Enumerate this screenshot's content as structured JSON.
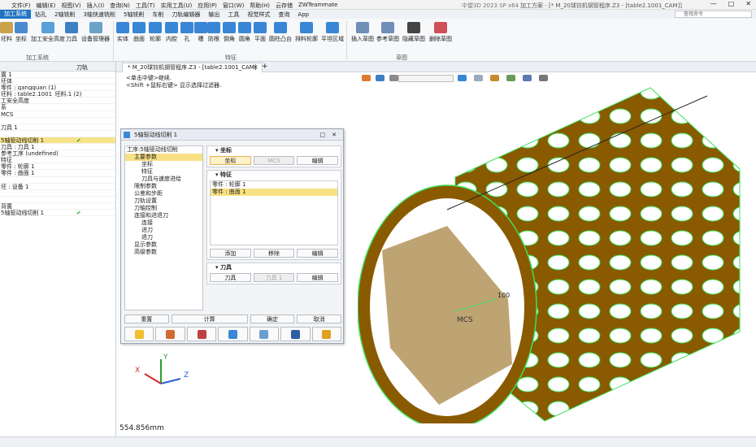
{
  "titlebar": {
    "menus": [
      "文件(F)",
      "编辑(E)",
      "视图(V)",
      "插入(I)",
      "查询(N)",
      "工具(T)",
      "实用工具(U)",
      "应用(P)",
      "窗口(W)",
      "帮助(H)",
      "云存储",
      "ZWTeammate"
    ],
    "product": "中望3D 2023 SP x64",
    "doc_title": "加工方案 - [* M_20球铰机钢管程序.Z3 - [table2.1001_CAM]]"
  },
  "tabs": [
    "加工系统",
    "钻孔",
    "2轴铣削",
    "3轴快速铣削",
    "5轴铣削",
    "车削",
    "刀轨编辑器",
    "输出",
    "工具",
    "视觉样式",
    "查询",
    "App"
  ],
  "search_placeholder": "查找命令",
  "ribbon": {
    "group1": {
      "label": "加工系统",
      "buttons": [
        "坯料",
        "坐标",
        "加工安全高度",
        "刀具",
        "设备管理器"
      ]
    },
    "group2": {
      "label": "特征",
      "buttons": [
        "实体",
        "曲面",
        "轮廓",
        "内腔",
        "孔",
        "槽",
        "防根",
        "倒角",
        "圆角",
        "平面",
        "圆柱凸台",
        "排料轮廓",
        "平坦区域"
      ]
    },
    "group3": {
      "label": "草图",
      "buttons": [
        "插入草图",
        "参考草图",
        "隐藏草图",
        "删除草图"
      ]
    }
  },
  "leftpanel": {
    "col": "刀轨",
    "rows": [
      {
        "t": "置 1"
      },
      {
        "t": "坯体"
      },
      {
        "t": "零件 : gangguan (1)"
      },
      {
        "t": "坯料 : table2.1001_坯料.1 (2)"
      },
      {
        "t": "工安全高度"
      },
      {
        "t": "系"
      },
      {
        "t": "MCS"
      },
      {
        "t": ""
      },
      {
        "t": "刀具 1"
      },
      {
        "t": ""
      },
      {
        "t": "5轴驱动线切削 1",
        "sel": true,
        "check": true
      },
      {
        "t": "刀具 : 刀具 1"
      },
      {
        "t": "参考工序 (undefined)"
      },
      {
        "t": "特征"
      },
      {
        "t": "零件 : 轮廓 1"
      },
      {
        "t": "零件 : 曲面 1"
      },
      {
        "t": ""
      },
      {
        "t": "坯 : 设备 1"
      },
      {
        "t": ""
      },
      {
        "t": ""
      },
      {
        "t": "背置"
      },
      {
        "t": "5轴驱动线切削 1",
        "check": true
      }
    ]
  },
  "doc_tab": "* M_20球铰机钢管程序.Z3 - [table2.1001_CAM]",
  "hints": [
    "<单击中键>继续.",
    "<Shift +鼠标右键> 显示选择过滤器."
  ],
  "dialog": {
    "title": "5轴驱动线切削 1",
    "tree": [
      {
        "t": "工序:5轴驱动线切削",
        "l": 0
      },
      {
        "t": "主要参数",
        "l": 1,
        "sel": true
      },
      {
        "t": "坐标",
        "l": 2
      },
      {
        "t": "特征",
        "l": 2
      },
      {
        "t": "刀具与速度进给",
        "l": 2
      },
      {
        "t": "限制参数",
        "l": 1
      },
      {
        "t": "公差和步距",
        "l": 1
      },
      {
        "t": "刀轨设置",
        "l": 1
      },
      {
        "t": "刀轴控制",
        "l": 1
      },
      {
        "t": "连接和进退刀",
        "l": 1
      },
      {
        "t": "连接",
        "l": 2
      },
      {
        "t": "进刀",
        "l": 2
      },
      {
        "t": "退刀",
        "l": 2
      },
      {
        "t": "显示参数",
        "l": 1
      },
      {
        "t": "高级参数",
        "l": 1
      }
    ],
    "coord": {
      "header": "坐标",
      "btn": "坐标",
      "value": "MCS",
      "edit": "编辑"
    },
    "feature": {
      "header": "特征",
      "items": [
        "零件 : 轮廓 1",
        "零件 : 曲面 1"
      ],
      "add": "添加",
      "remove": "移除",
      "edit": "编辑"
    },
    "tool": {
      "header": "刀具",
      "btn": "刀具",
      "value": "刀具 1",
      "edit": "编辑"
    },
    "bottom": [
      "重置",
      "计算",
      "确定",
      "取消"
    ]
  },
  "measure": "554.856mm",
  "triad": {
    "x": "X",
    "y": "Y",
    "z": "Z"
  },
  "mcs_label": "MCS",
  "dim_label": "100",
  "colors": {
    "accent": "#1f74c4",
    "model": "#8a5a00",
    "toolpath": "#3ee05a",
    "select": "#f8e183"
  }
}
